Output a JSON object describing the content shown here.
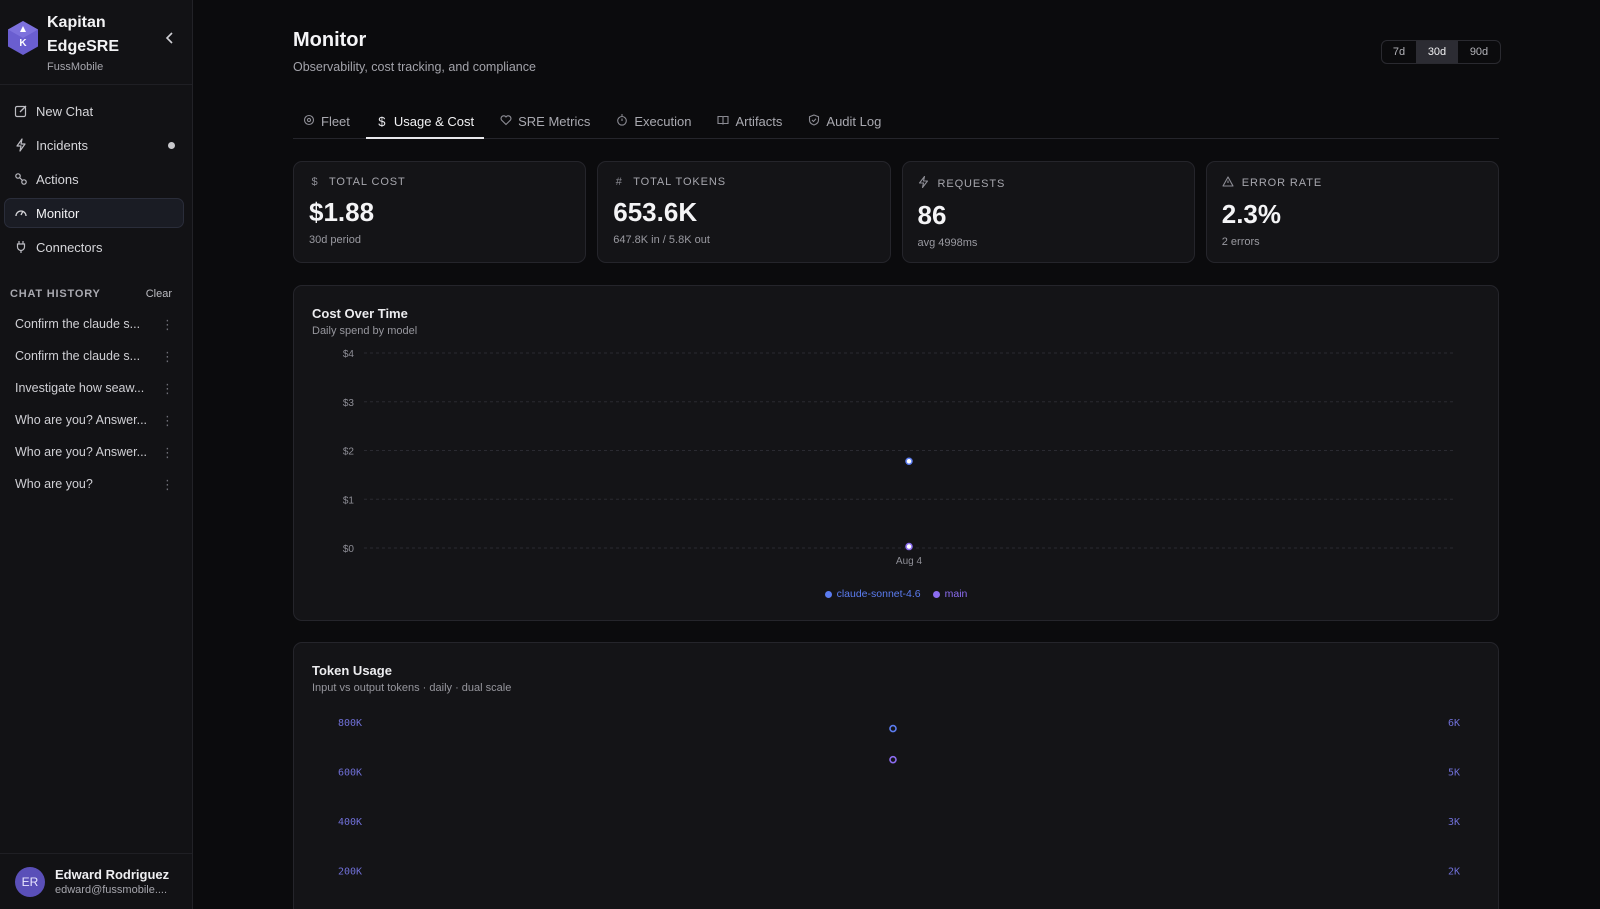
{
  "brand": {
    "name": "Kapitan EdgeSRE",
    "org": "FussMobile",
    "logo_letter": "K"
  },
  "nav": {
    "items": [
      {
        "label": "New Chat",
        "icon": "edit-icon"
      },
      {
        "label": "Incidents",
        "icon": "bolt-icon"
      },
      {
        "label": "Actions",
        "icon": "actions-icon"
      },
      {
        "label": "Monitor",
        "icon": "gauge-icon"
      },
      {
        "label": "Connectors",
        "icon": "plug-icon"
      }
    ]
  },
  "history": {
    "title": "CHAT HISTORY",
    "clear_label": "Clear",
    "items": [
      "Confirm the claude s...",
      "Confirm the claude s...",
      "Investigate how seaw...",
      "Who are you? Answer...",
      "Who are you? Answer...",
      "Who are you?"
    ]
  },
  "user": {
    "initials": "ER",
    "name": "Edward Rodriguez",
    "email": "edward@fussmobile...."
  },
  "page": {
    "title": "Monitor",
    "subtitle": "Observability, cost tracking, and compliance"
  },
  "range": {
    "options": [
      "7d",
      "30d",
      "90d"
    ],
    "selected": "30d"
  },
  "tabs": [
    {
      "label": "Fleet",
      "icon": "fleet-icon"
    },
    {
      "label": "Usage & Cost",
      "icon": "dollar-icon"
    },
    {
      "label": "SRE Metrics",
      "icon": "heart-icon"
    },
    {
      "label": "Execution",
      "icon": "timer-icon"
    },
    {
      "label": "Artifacts",
      "icon": "book-icon"
    },
    {
      "label": "Audit Log",
      "icon": "shield-icon"
    }
  ],
  "active_tab": "Usage & Cost",
  "cards": [
    {
      "label": "TOTAL COST",
      "icon": "dollar-icon",
      "value": "$1.88",
      "note": "30d period"
    },
    {
      "label": "TOTAL TOKENS",
      "icon": "hash-icon",
      "value": "653.6K",
      "note": "647.8K in / 5.8K out"
    },
    {
      "label": "REQUESTS",
      "icon": "bolt-icon",
      "value": "86",
      "note": "avg 4998ms"
    },
    {
      "label": "ERROR RATE",
      "icon": "warning-icon",
      "value": "2.3%",
      "note": "2 errors"
    }
  ],
  "colors": {
    "accent_blue": "#5b7cf0",
    "accent_purple": "#8b6cf0"
  },
  "chart_data": [
    {
      "type": "scatter",
      "title": "Cost Over Time",
      "subtitle": "Daily spend by model",
      "x": [
        "Aug 4"
      ],
      "y_ticks": [
        "$0",
        "$1",
        "$2",
        "$3",
        "$4"
      ],
      "ylim": [
        0,
        4
      ],
      "series": [
        {
          "name": "claude-sonnet-4.6",
          "color": "#5b7cf0",
          "values": [
            1.78
          ]
        },
        {
          "name": "main",
          "color": "#8b6cf0",
          "values": [
            0.03
          ]
        }
      ],
      "legend": "bottom-center",
      "grid": true
    },
    {
      "type": "scatter",
      "title": "Token Usage",
      "subtitle": "Input vs output tokens · daily · dual scale",
      "y_left_ticks": [
        "200K",
        "400K",
        "600K",
        "800K"
      ],
      "y_right_ticks": [
        "2K",
        "3K",
        "5K",
        "6K"
      ],
      "ylim_left": [
        0,
        800000
      ],
      "ylim_right": [
        0,
        6000
      ],
      "series": [
        {
          "axis": "left",
          "color": "#8b6cf0",
          "values": [
            647800
          ]
        },
        {
          "axis": "right",
          "color": "#5b7cf0",
          "values": [
            5800
          ]
        }
      ]
    }
  ]
}
